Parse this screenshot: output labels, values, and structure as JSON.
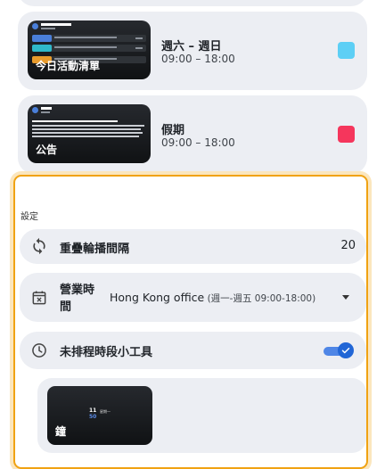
{
  "cards": [
    {
      "caption": "今日活動清單",
      "title": "週六 – 週日",
      "time": "09:00 – 18:00",
      "color": "#5dcff5"
    },
    {
      "caption": "公告",
      "title": "假期",
      "time": "09:00 – 18:00",
      "color": "#f5365c"
    }
  ],
  "settings": {
    "label": "設定",
    "rotation": {
      "label": "重疊輪播間隔",
      "value": "20"
    },
    "hours": {
      "label": "營業時間",
      "selected": "Hong Kong office",
      "selected_detail": " (週一-週五 09:00-18:00)"
    },
    "widget": {
      "label": "未排程時段小工具",
      "enabled": true
    },
    "clock": {
      "caption": "鐘",
      "hour": "11",
      "minute": "50",
      "weekday": "星期一"
    }
  },
  "icons": [
    "sync-icon",
    "calendar-x-icon",
    "clock-icon",
    "checkmark-icon",
    "caret-down-icon"
  ]
}
